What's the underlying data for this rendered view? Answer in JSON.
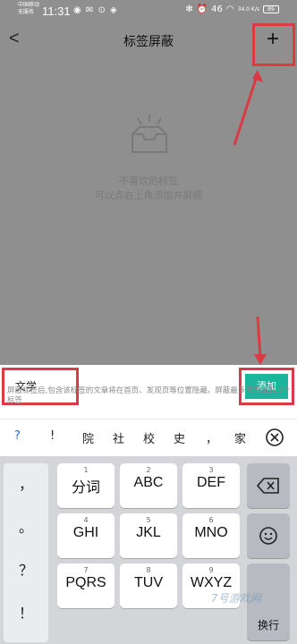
{
  "status_bar": {
    "carrier_line1": "中国移动",
    "carrier_line2": "无服务",
    "time": "11:31",
    "signal_text": "46",
    "speed": "34.0 K/s",
    "battery": "89"
  },
  "nav": {
    "back_label": "<",
    "title": "标签屏蔽",
    "add_label": "+"
  },
  "empty_state": {
    "line1": "不喜欢的标签",
    "line2": "可以点右上角添加并屏蔽"
  },
  "input": {
    "value": "文学",
    "add_button": "添加",
    "hint": "屏蔽标签后,包含该标签的文章将在首页、发现页等位置隐藏。屏蔽最多可添加100个标签"
  },
  "candidates": [
    "?",
    "!",
    "院",
    "社",
    "校",
    "史",
    "，",
    "家"
  ],
  "keyboard": {
    "punctuation": [
      "，",
      "。",
      "？",
      "！"
    ],
    "rows": [
      [
        {
          "num": "1",
          "label": "分词"
        },
        {
          "num": "2",
          "label": "ABC"
        },
        {
          "num": "3",
          "label": "DEF"
        }
      ],
      [
        {
          "num": "4",
          "label": "GHI"
        },
        {
          "num": "5",
          "label": "JKL"
        },
        {
          "num": "6",
          "label": "MNO"
        }
      ],
      [
        {
          "num": "7",
          "label": "PQRS"
        },
        {
          "num": "8",
          "label": "TUV"
        },
        {
          "num": "9",
          "label": "WXYZ"
        }
      ]
    ],
    "newline_label": "换行"
  },
  "watermark": "7号游戏网"
}
